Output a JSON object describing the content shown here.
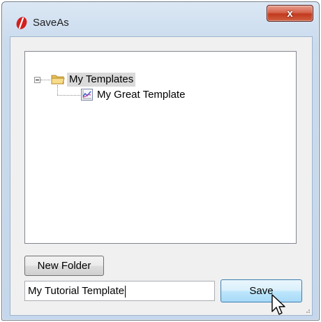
{
  "window": {
    "title": "SaveAs",
    "close_label": "x",
    "app_icon": "app-logo-icon"
  },
  "tree": {
    "root": {
      "label": "My Templates",
      "icon": "folder-icon",
      "expanded": true
    },
    "children": [
      {
        "label": "My Great Template",
        "icon": "chart-template-icon"
      }
    ]
  },
  "buttons": {
    "new_folder": "New Folder",
    "save": "Save"
  },
  "filename_input": {
    "value": "My Tutorial Template"
  },
  "colors": {
    "close_button": "#c2391f",
    "save_button_border": "#3c7fb1",
    "selection_bg": "#dadada"
  }
}
